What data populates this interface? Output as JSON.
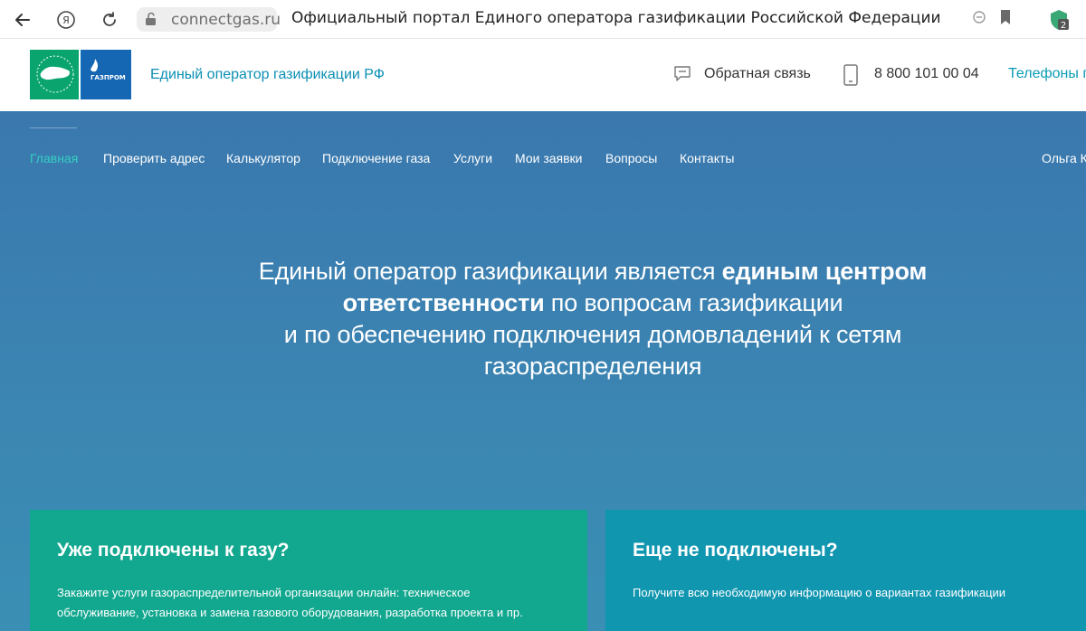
{
  "browser": {
    "url": "connectgas.ru",
    "page_title": "Официальный портал Единого оператора газификации Российской Федерации",
    "tab_count": "2"
  },
  "header": {
    "brand": "Единый оператор газификации РФ",
    "feedback": "Обратная связь",
    "phone": "8 800 101 00 04",
    "phones_link": "Телефоны г"
  },
  "nav": {
    "items": [
      "Главная",
      "Проверить адрес",
      "Калькулятор",
      "Подключение газа",
      "Услуги",
      "Мои заявки",
      "Вопросы",
      "Контакты"
    ],
    "active": "Главная",
    "user": "Ольга К"
  },
  "hero": {
    "line1_normal": "Единый оператор газификации является ",
    "line1_bold": "единым центром",
    "line2_bold": "ответственности",
    "line2_normal": " по вопросам газификации",
    "line3": "и по обеспечению подключения домовладений к сетям",
    "line4": "газораспределения"
  },
  "cards": {
    "connected": {
      "title": "Уже подключены к газу?",
      "desc_line1": "Закажите услуги газораспределительной организации онлайн: техническое",
      "desc_line2": "обслуживание, установка и замена газового оборудования, разработка проекта и пр."
    },
    "not_connected": {
      "title": "Еще не подключены?",
      "desc": "Получите всю необходимую информацию о вариантах газификации"
    }
  },
  "colors": {
    "accent": "#35d0c2",
    "brand_text": "#0b8fb4",
    "card_green": "#12a78f",
    "card_teal": "#1196b0"
  }
}
